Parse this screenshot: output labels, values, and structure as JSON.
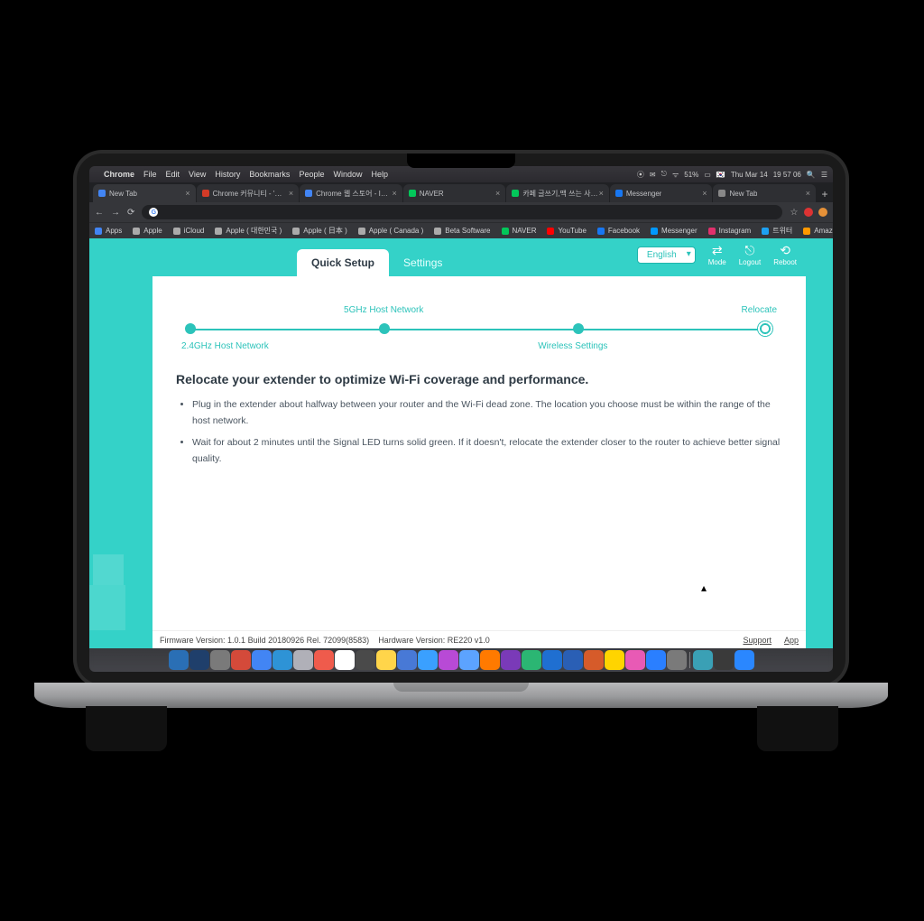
{
  "menubar": {
    "apple": "",
    "app": "Chrome",
    "items": [
      "File",
      "Edit",
      "View",
      "History",
      "Bookmarks",
      "People",
      "Window",
      "Help"
    ],
    "right": {
      "battery": "51%",
      "day": "Thu Mar 14",
      "time": "19 57 06"
    }
  },
  "tabs": [
    {
      "label": "New Tab",
      "color": "#4285f4"
    },
    {
      "label": "Chrome 커뮤니티 - '…",
      "color": "#d33b27"
    },
    {
      "label": "Chrome 웹 스토어 - I…",
      "color": "#4285f4"
    },
    {
      "label": "NAVER",
      "color": "#03c75a"
    },
    {
      "label": "카페 글쓰기,맥 쓰는 사…",
      "color": "#03c75a"
    },
    {
      "label": "Messenger",
      "color": "#1877f2"
    },
    {
      "label": "New Tab",
      "color": "#888"
    }
  ],
  "omnibox": {
    "icon": "G",
    "text": ""
  },
  "bookmarks": [
    {
      "label": "Apps",
      "color": "#4285f4"
    },
    {
      "label": "Apple",
      "color": "#aaa"
    },
    {
      "label": "iCloud",
      "color": "#aaa"
    },
    {
      "label": "Apple ( 대한민국 )",
      "color": "#aaa"
    },
    {
      "label": "Apple ( 日本 )",
      "color": "#aaa"
    },
    {
      "label": "Apple ( Canada )",
      "color": "#aaa"
    },
    {
      "label": "Beta Software",
      "color": "#aaa"
    },
    {
      "label": "NAVER",
      "color": "#03c75a"
    },
    {
      "label": "YouTube",
      "color": "#ff0000"
    },
    {
      "label": "Facebook",
      "color": "#1877f2"
    },
    {
      "label": "Messenger",
      "color": "#0099ff"
    },
    {
      "label": "Instagram",
      "color": "#e1306c"
    },
    {
      "label": "트위터",
      "color": "#1da1f2"
    },
    {
      "label": "Amazon",
      "color": "#ff9900"
    }
  ],
  "router": {
    "tabs": {
      "quicksetup": "Quick Setup",
      "settings": "Settings"
    },
    "language": "English",
    "actions": {
      "mode": "Mode",
      "logout": "Logout",
      "reboot": "Reboot"
    },
    "steps": {
      "s1": "2.4GHz Host Network",
      "s2": "5GHz Host Network",
      "s3": "Wireless Settings",
      "s4": "Relocate"
    },
    "heading": "Relocate your extender to optimize Wi-Fi coverage and performance.",
    "bullets": [
      "Plug in the extender about halfway between your router and the Wi-Fi dead zone. The location you choose must be within the range of the host network.",
      "Wait for about 2 minutes until the Signal LED turns solid green. If it doesn't, relocate the extender closer to the router to achieve better signal quality."
    ],
    "footer": {
      "fw_label": "Firmware Version:",
      "fw": "1.0.1 Build 20180926 Rel. 72099(8583)",
      "hw_label": "Hardware Version:",
      "hw": "RE220 v1.0",
      "support": "Support",
      "app": "App"
    }
  },
  "dock_colors": [
    "#2a6fb5",
    "#1f3f6b",
    "#7a7a7a",
    "#d44a3a",
    "#4285f4",
    "#2e93d6",
    "#b0b0b8",
    "#ef5b4c",
    "#ffffff",
    "#4a4a4a",
    "#ffd54a",
    "#4879d6",
    "#3aa0ff",
    "#b84ad6",
    "#5ca3ff",
    "#ff7a00",
    "#7a3ab8",
    "#2bb673",
    "#1f6fd1",
    "#2a5fb5",
    "#d65b2a",
    "#ffd400",
    "#e85ab5",
    "#2a7fff",
    "#7a7a7a",
    "#3aa0b5",
    "#3a3a3a",
    "#2a87ff"
  ]
}
